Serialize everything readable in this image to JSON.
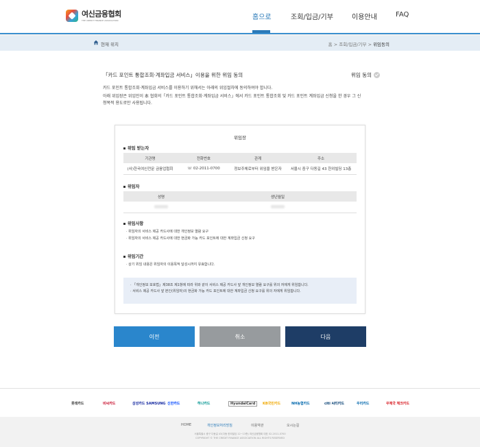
{
  "header": {
    "logo_ko": "여신금융협회",
    "logo_en": "THE CREDIT FINANCE ASSOCIATION",
    "nav": [
      "홈으로",
      "조회/입금/기부",
      "이용안내",
      "FAQ"
    ]
  },
  "breadcrumb": {
    "location_label": "현재 위치",
    "items": [
      "홈",
      "조회/입금/기부",
      "위임동의"
    ]
  },
  "page": {
    "title": "「카드 포인트 통합조회·계좌입금 서비스」이용을 위한 위임 동의",
    "consent_label": "위임 동의",
    "desc1": "카드 포인트 통합조회·계좌입금 서비스를 이용하기 위해서는 아래의 위임절차에 동의하여야 합니다.",
    "desc2": "아래 위임장은 위임인이 本 협회의「카드 포인트 통합조회·계좌입금 서비스」에서 카드 포인트 통합조회 및 카드 포인트 계좌입금 신청을 한 경우 그 신",
    "desc3": "청목적 용도로만 사용됩니다."
  },
  "card": {
    "title": "위임장",
    "sec_receiver": "위임 받는자",
    "receiver_headers": [
      "기관명",
      "전화번호",
      "관계",
      "주소"
    ],
    "receiver_row": [
      "(사)한국여신전문 금융업협회",
      "☏ 02-2011-0700",
      "정보주체로부터 위임을 받은자",
      "서울시 중구 다동길 43 한외빌딩 13층"
    ],
    "sec_delegator": "위임자",
    "delegator_headers": [
      "성명",
      "생년월일"
    ],
    "sec_matters": "위임사항",
    "matters": [
      "· 위임자의 서비스 제공 카드사에 대한 개인정보 열람 요구",
      "· 위임자의 서비스 제공 카드사에 대한 현금화 가능 카드 포인트에 대한 계좌입금 신청 요구"
    ],
    "sec_period": "위임기간",
    "period": "· 상기 위임 내용은 위임자의 이용목적 달성시까지 유효합니다.",
    "notice": [
      "· 「개인정보 보호법」제38조 제1항에 따라 위와 같이 서비스 제공 카드사 앞 개인정보 열람 요구를 위의 자에게 위임합니다.",
      "· 서비스 제공 카드사 앞 본인(위임자)의 현금화 가능 카드 포인트에 대한 계좌입금 신청 요구를 위의 자에게 위임합니다."
    ]
  },
  "buttons": {
    "prev": "이전",
    "cancel": "취소",
    "next": "다음"
  },
  "partners": [
    "롯데카드",
    "비씨카드",
    "삼성카드 SAMSUNG",
    "신한카드",
    "하나카드",
    "HyundaiCard",
    "KB국민카드",
    "NH농협카드",
    "citi 씨티카드",
    "우리카드",
    "우체국 체크카드"
  ],
  "footer": {
    "links": [
      "HOME",
      "개인정보처리방침",
      "이용약관",
      "오시는길"
    ],
    "address": "서울특별시 중구 다동길 43(다동 한외빌딩 12~13층) 여신금융협회 대표 02-2011-0700",
    "copyright": "COPYRIGHT © THE CREDIT FINANCE ASSOCIATION ALL RIGHTS RESERVED"
  },
  "colors": {
    "accent": "#2a7ab8",
    "prev_button": "#2a86cc",
    "cancel_button": "#979b9e",
    "next_button": "#1e3d66"
  }
}
